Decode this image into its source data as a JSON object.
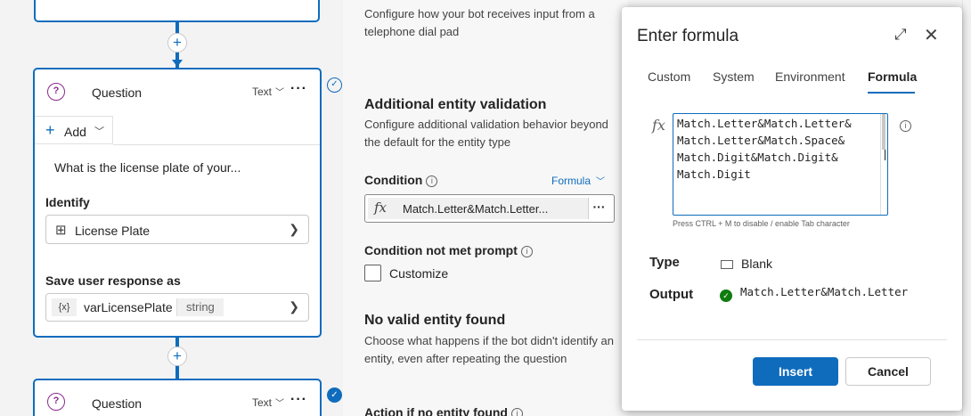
{
  "canvas": {
    "top_node_partial_text": "",
    "main_node": {
      "title": "Question",
      "type": "Text",
      "more": "···",
      "add_label": "Add",
      "prompt": "What is the license plate of your...",
      "identify_label": "Identify",
      "entity": "License Plate",
      "save_label": "Save user response as",
      "var_icon": "{x}",
      "var_name": "varLicensePlate",
      "var_type": "string"
    },
    "bottom_node": {
      "title": "Question",
      "type": "Text",
      "more": "···"
    },
    "plus_symbol": "+"
  },
  "properties": {
    "dialpad_desc": "Configure how your bot receives input from a telephone dial pad",
    "additional_validation": {
      "title": "Additional entity validation",
      "desc": "Configure additional validation behavior beyond the default for the entity type"
    },
    "condition": {
      "label": "Condition",
      "mode": "Formula",
      "fx": "fx",
      "value": "Match.Letter&Match.Letter..."
    },
    "condition_not_met": {
      "label": "Condition not met prompt",
      "customize": "Customize"
    },
    "no_entity": {
      "title": "No valid entity found",
      "desc": "Choose what happens if the bot didn't identify an entity, even after repeating the question"
    },
    "action_no_entity": "Action if no entity found"
  },
  "modal": {
    "title": "Enter formula",
    "tabs": [
      "Custom",
      "System",
      "Environment",
      "Formula"
    ],
    "active_tab": "Formula",
    "fx": "fx",
    "formula_lines": [
      "Match.Letter&Match.Letter&",
      "Match.Letter&Match.Space&",
      "Match.Digit&Match.Digit&",
      "Match.Digit"
    ],
    "hint": "Press CTRL + M to disable / enable Tab character",
    "type_label": "Type",
    "type_value": "Blank",
    "output_label": "Output",
    "output_value": "Match.Letter&Match.Letter",
    "insert_label": "Insert",
    "cancel_label": "Cancel"
  },
  "colors": {
    "accent": "#0f6cbd",
    "success": "#107c10",
    "question_icon": "#8a2b8e"
  }
}
